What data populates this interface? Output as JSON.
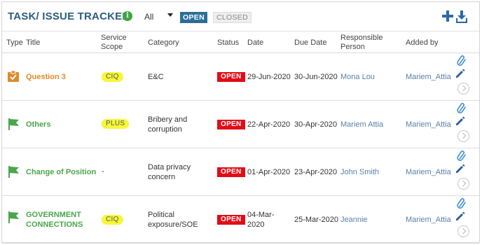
{
  "header": {
    "title": "TASK/ ISSUE TRACKER",
    "info_icon": "info-icon",
    "filter_value": "All",
    "toggle_open": "OPEN",
    "toggle_closed": "CLOSED",
    "add_icon": "add-icon",
    "download_icon": "download-icon"
  },
  "columns": {
    "type": "Type",
    "title": "Title",
    "scope_line1": "Service",
    "scope_line2": "Scope",
    "category": "Category",
    "status": "Status",
    "date": "Date",
    "due": "Due Date",
    "person_line1": "Responsible",
    "person_line2": "Person",
    "added_by": "Added by"
  },
  "colors": {
    "accent": "#2b5d7c",
    "task_orange": "#e08a2a",
    "flag_green": "#4aa64a",
    "open_red": "#e20b17",
    "scope_yellow": "#f7f73a"
  },
  "rows": [
    {
      "type_icon": "clipboard-check-icon",
      "title_line1": "Question 3",
      "title_line2": "",
      "scope": "CIQ",
      "category_line1": "E&C",
      "category_line2": "",
      "status": "OPEN",
      "date_line1": "29-Jun-2020",
      "date_line2": "",
      "due": "30-Jun-2020",
      "person": "Mona Lou",
      "added_by": "Mariem_Attia"
    },
    {
      "type_icon": "flag-icon",
      "title_line1": "Others",
      "title_line2": "",
      "scope": "PLUS",
      "category_line1": "Bribery and",
      "category_line2": "corruption",
      "status": "OPEN",
      "date_line1": "22-Apr-2020",
      "date_line2": "",
      "due": "30-Apr-2020",
      "person": "Mariem Attia",
      "added_by": "Mariem_Attia"
    },
    {
      "type_icon": "flag-icon",
      "title_line1": "Change of Position",
      "title_line2": "",
      "scope": "-",
      "category_line1": "Data privacy",
      "category_line2": "concern",
      "status": "OPEN",
      "date_line1": "01-Apr-2020",
      "date_line2": "",
      "due": "23-Apr-2020",
      "person": "John Smith",
      "added_by": "Mariem_Attia"
    },
    {
      "type_icon": "flag-icon",
      "title_line1": "GOVERNMENT",
      "title_line2": "CONNECTIONS",
      "scope": "CIQ",
      "category_line1": "Political",
      "category_line2": "exposure/SOE",
      "status": "OPEN",
      "date_line1": "04-Mar-",
      "date_line2": "2020",
      "due": "25-Mar-2020",
      "person": "Jeannie",
      "added_by": "Mariem_Attia"
    }
  ]
}
